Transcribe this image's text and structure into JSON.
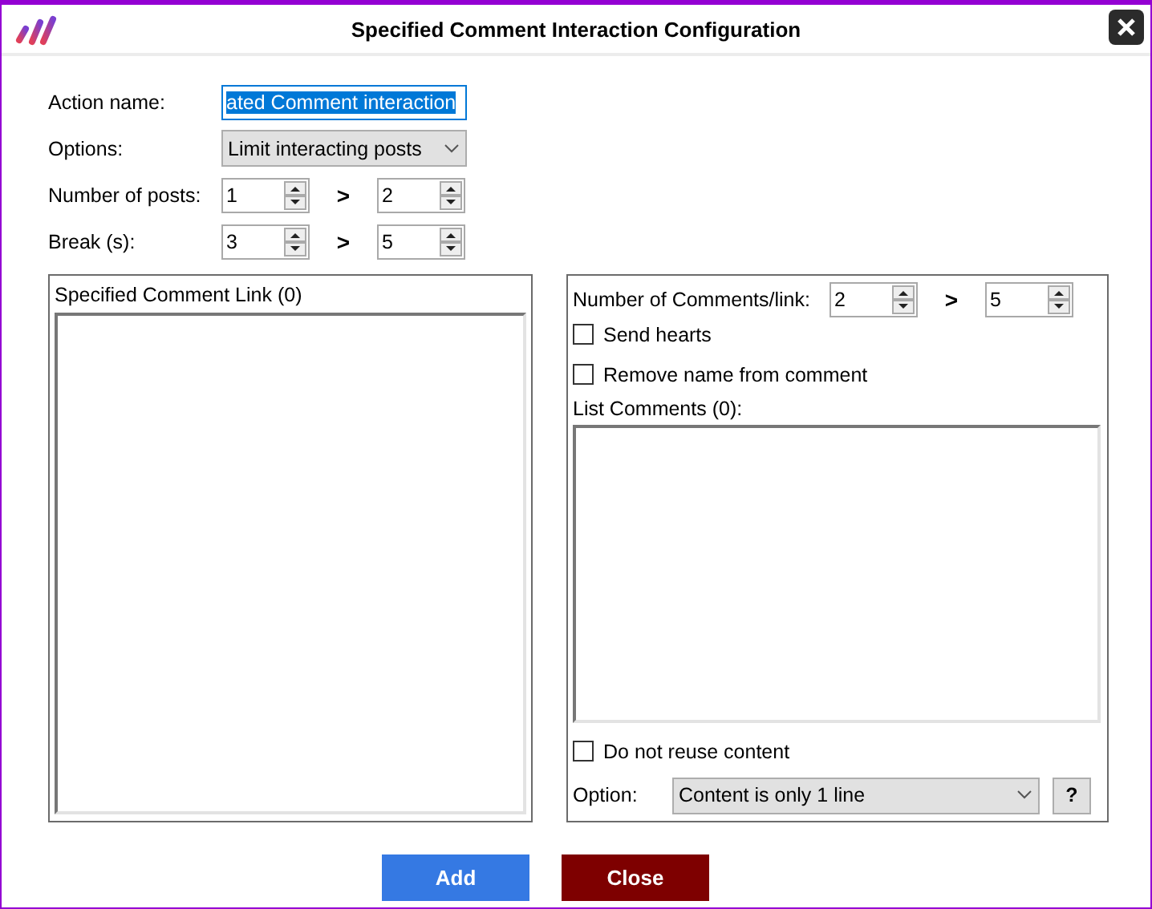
{
  "window": {
    "title": "Specified Comment Interaction Configuration"
  },
  "action_name": {
    "label": "Action name:",
    "value": "ated Comment interaction",
    "selected": true
  },
  "options": {
    "label": "Options:",
    "value": "Limit interacting posts"
  },
  "number_of_posts": {
    "label": "Number of posts:",
    "from": "1",
    "separator": ">",
    "to": "2"
  },
  "break": {
    "label": "Break (s):",
    "from": "3",
    "separator": ">",
    "to": "5"
  },
  "link_panel": {
    "title": "Specified Comment Link (0)"
  },
  "comments_panel": {
    "count_label": "Number of Comments/link:",
    "from": "2",
    "separator": ">",
    "to": "5",
    "checkboxes": [
      {
        "label": "Send hearts",
        "checked": false
      },
      {
        "label": "Remove name from comment",
        "checked": false
      }
    ],
    "list_label": "List Comments (0):",
    "reuse": {
      "label": "Do not reuse content",
      "checked": false
    },
    "option": {
      "label": "Option:",
      "value": "Content is only 1 line"
    },
    "help": "?"
  },
  "buttons": [
    {
      "label": "Add",
      "kind": "primary"
    },
    {
      "label": "Close",
      "kind": "danger"
    }
  ]
}
